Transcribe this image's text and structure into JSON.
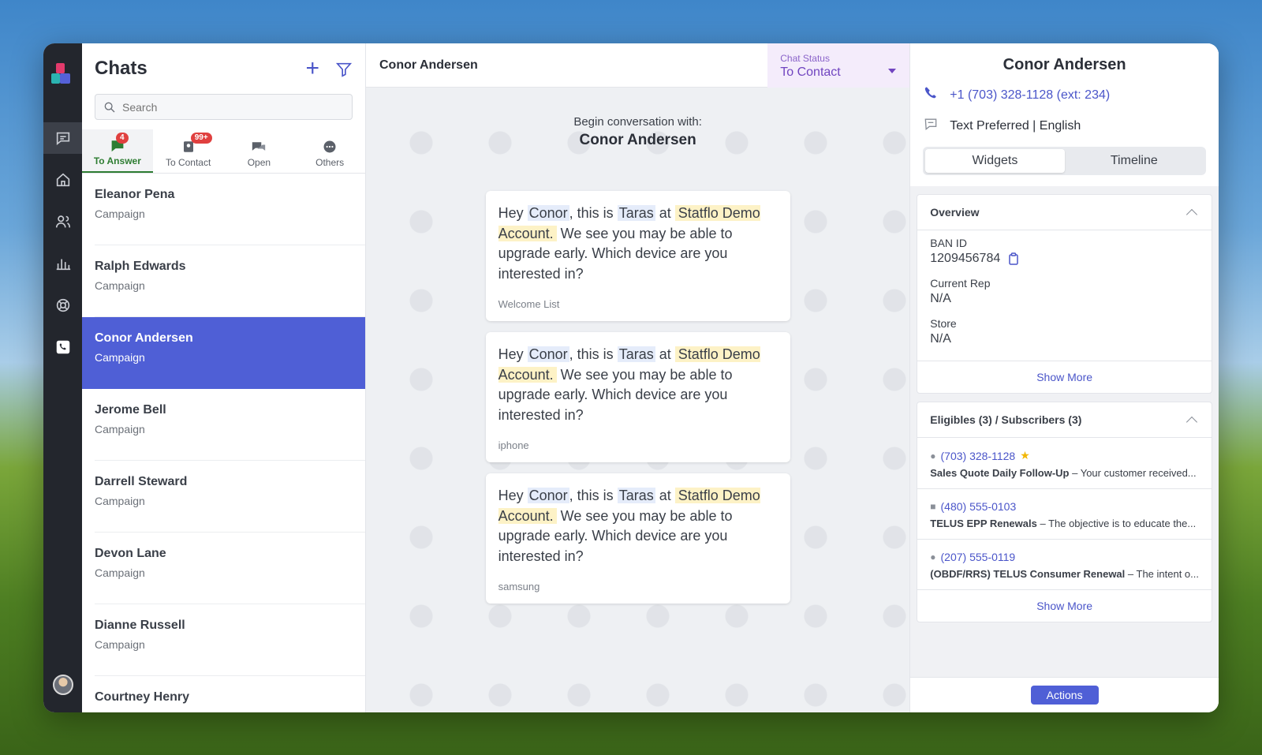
{
  "colors": {
    "accent": "#4f5fd6",
    "status_bg": "#f4ecfb",
    "answer_green": "#2e7d32",
    "badge_red": "#e0403f"
  },
  "rail": {
    "icons": [
      "chat-icon",
      "home-icon",
      "people-icon",
      "chart-icon",
      "lifebuoy-icon",
      "phone-icon"
    ]
  },
  "list": {
    "title": "Chats",
    "search_placeholder": "Search",
    "tabs": [
      {
        "label": "To Answer",
        "badge": "4"
      },
      {
        "label": "To Contact",
        "badge": "99+"
      },
      {
        "label": "Open"
      },
      {
        "label": "Others"
      }
    ],
    "chats": [
      {
        "name": "Eleanor Pena",
        "sub": "Campaign"
      },
      {
        "name": "Ralph Edwards",
        "sub": "Campaign"
      },
      {
        "name": "Conor Andersen",
        "sub": "Campaign"
      },
      {
        "name": "Jerome Bell",
        "sub": "Campaign"
      },
      {
        "name": "Darrell Steward",
        "sub": "Campaign"
      },
      {
        "name": "Devon Lane",
        "sub": "Campaign"
      },
      {
        "name": "Dianne Russell",
        "sub": "Campaign"
      },
      {
        "name": "Courtney Henry",
        "sub": ""
      }
    ]
  },
  "conv": {
    "contact": "Conor Andersen",
    "status_label": "Chat Status",
    "status_value": "To Contact",
    "begin_label": "Begin conversation with:",
    "begin_name": "Conor Andersen",
    "messages": [
      {
        "p1": "Hey ",
        "name": "Conor",
        "p2": ", this is ",
        "agent": "Taras",
        "p3": " at ",
        "company": "Statflo Demo Account.",
        "p4": " We see you may be able to upgrade early. Which device are you interested in?",
        "tag": "Welcome List"
      },
      {
        "p1": "Hey ",
        "name": "Conor",
        "p2": ", this is ",
        "agent": "Taras",
        "p3": " at ",
        "company": "Statflo Demo Account.",
        "p4": " We see you may be able to upgrade early. Which device are you interested in?",
        "tag": "iphone"
      },
      {
        "p1": "Hey ",
        "name": "Conor",
        "p2": ", this is ",
        "agent": "Taras",
        "p3": " at ",
        "company": "Statflo Demo Account.",
        "p4": " We see you may be able to upgrade early. Which device are you interested in?",
        "tag": "samsung"
      }
    ]
  },
  "side": {
    "name": "Conor Andersen",
    "phone": "+1 (703) 328-1128 (ext: 234)",
    "pref": "Text Preferred | English",
    "seg": [
      "Widgets",
      "Timeline"
    ],
    "overview": {
      "title": "Overview",
      "fields": [
        {
          "k": "BAN ID",
          "v": "1209456784"
        },
        {
          "k": "Current Rep",
          "v": "N/A"
        },
        {
          "k": "Store",
          "v": "N/A"
        }
      ],
      "more": "Show More"
    },
    "eligibles": {
      "title": "Eligibles (3) / Subscribers (3)",
      "items": [
        {
          "phone": "(703) 328-1128",
          "bold": "Sales Quote Daily Follow-Up",
          "rest": " – Your customer received..."
        },
        {
          "phone": "(480) 555-0103",
          "bold": "TELUS EPP Renewals",
          "rest": " – The objective is to educate the..."
        },
        {
          "phone": "(207) 555-0119",
          "bold": "(OBDF/RRS) TELUS Consumer Renewal",
          "rest": " – The intent o..."
        }
      ],
      "more": "Show More"
    },
    "actions": "Actions"
  }
}
